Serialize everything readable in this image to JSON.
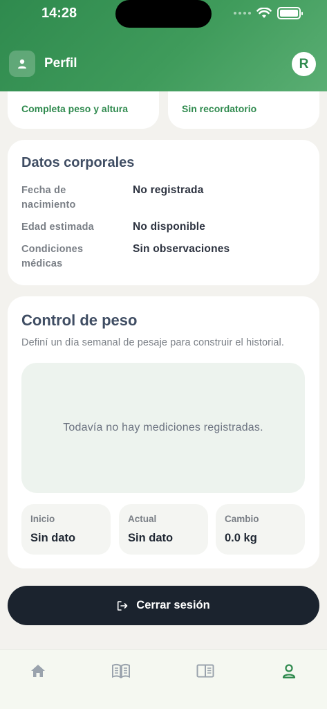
{
  "status_bar": {
    "time": "14:28"
  },
  "header": {
    "title": "Perfil",
    "avatar_initial": "R"
  },
  "top_cards": {
    "left_link": "Completa peso y altura",
    "right_link": "Sin recordatorio"
  },
  "body_data": {
    "title": "Datos corporales",
    "rows": [
      {
        "label": "Fecha de nacimiento",
        "value": "No registrada"
      },
      {
        "label": "Edad estimada",
        "value": "No disponible"
      },
      {
        "label": "Condiciones médicas",
        "value": "Sin observaciones"
      }
    ]
  },
  "weight": {
    "title": "Control de peso",
    "subtitle": "Definí un día semanal de pesaje para construir el historial.",
    "empty_message": "Todavía no hay mediciones registradas.",
    "stats": [
      {
        "label": "Inicio",
        "value": "Sin dato"
      },
      {
        "label": "Actual",
        "value": "Sin dato"
      },
      {
        "label": "Cambio",
        "value": "0.0 kg"
      }
    ]
  },
  "logout": {
    "label": "Cerrar sesión"
  },
  "tabbar": {
    "tabs": [
      {
        "icon": "home-icon",
        "active": false
      },
      {
        "icon": "open-book-icon",
        "active": false
      },
      {
        "icon": "reader-icon",
        "active": false
      },
      {
        "icon": "profile-icon",
        "active": true
      }
    ],
    "active_color": "#2f8a4e",
    "inactive_color": "#9aa3ad"
  }
}
